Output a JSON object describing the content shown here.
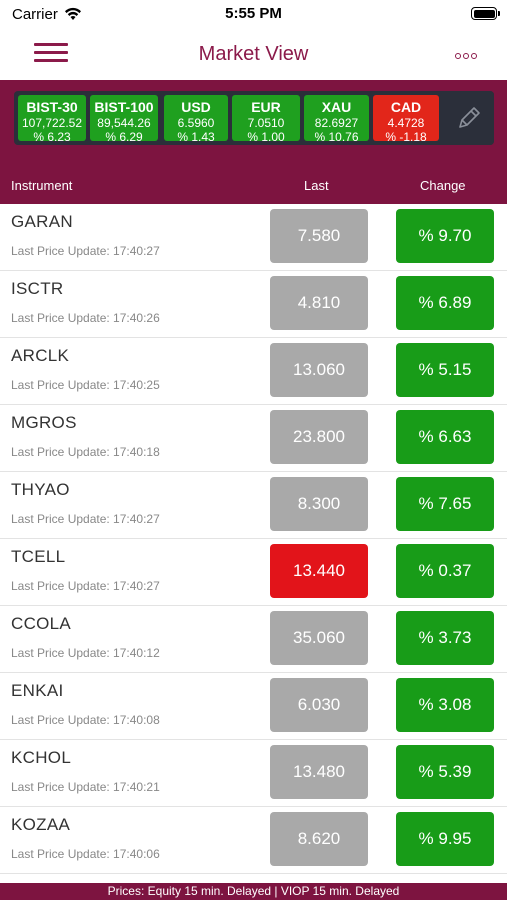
{
  "status_bar": {
    "carrier": "Carrier",
    "time": "5:55 PM"
  },
  "nav": {
    "title": "Market View"
  },
  "tickers": [
    {
      "name": "BIST-30",
      "value": "107,722.52",
      "change": "% 6.23",
      "trend": "up"
    },
    {
      "name": "BIST-100",
      "value": "89,544.26",
      "change": "% 6.29",
      "trend": "up"
    },
    {
      "name": "USD",
      "value": "6.5960",
      "change": "% 1.43",
      "trend": "up"
    },
    {
      "name": "EUR",
      "value": "7.0510",
      "change": "% 1.00",
      "trend": "up"
    },
    {
      "name": "XAU",
      "value": "82.6927",
      "change": "% 10.76",
      "trend": "up"
    },
    {
      "name": "CAD",
      "value": "4.4728",
      "change": "% -1.18",
      "trend": "down"
    }
  ],
  "columns": {
    "instrument": "Instrument",
    "last": "Last",
    "change": "Change"
  },
  "instruments": [
    {
      "symbol": "GARAN",
      "update": "Last Price Update: 17:40:27",
      "last": "7.580",
      "last_state": "neutral",
      "change": "% 9.70"
    },
    {
      "symbol": "ISCTR",
      "update": "Last Price Update: 17:40:26",
      "last": "4.810",
      "last_state": "neutral",
      "change": "% 6.89"
    },
    {
      "symbol": "ARCLK",
      "update": "Last Price Update: 17:40:25",
      "last": "13.060",
      "last_state": "neutral",
      "change": "% 5.15"
    },
    {
      "symbol": "MGROS",
      "update": "Last Price Update: 17:40:18",
      "last": "23.800",
      "last_state": "neutral",
      "change": "% 6.63"
    },
    {
      "symbol": "THYAO",
      "update": "Last Price Update: 17:40:27",
      "last": "8.300",
      "last_state": "neutral",
      "change": "% 7.65"
    },
    {
      "symbol": "TCELL",
      "update": "Last Price Update: 17:40:27",
      "last": "13.440",
      "last_state": "down",
      "change": "% 0.37"
    },
    {
      "symbol": "CCOLA",
      "update": "Last Price Update: 17:40:12",
      "last": "35.060",
      "last_state": "neutral",
      "change": "% 3.73"
    },
    {
      "symbol": "ENKAI",
      "update": "Last Price Update: 17:40:08",
      "last": "6.030",
      "last_state": "neutral",
      "change": "% 3.08"
    },
    {
      "symbol": "KCHOL",
      "update": "Last Price Update: 17:40:21",
      "last": "13.480",
      "last_state": "neutral",
      "change": "% 5.39"
    },
    {
      "symbol": "KOZAA",
      "update": "Last Price Update: 17:40:06",
      "last": "8.620",
      "last_state": "neutral",
      "change": "% 9.95"
    }
  ],
  "footer": {
    "text": "Prices: Equity 15 min. Delayed | VIOP 15 min. Delayed"
  },
  "colors": {
    "brand": "#7d1440",
    "up": "#189c18",
    "down": "#e2141a",
    "neutral": "#a9a9a9"
  }
}
